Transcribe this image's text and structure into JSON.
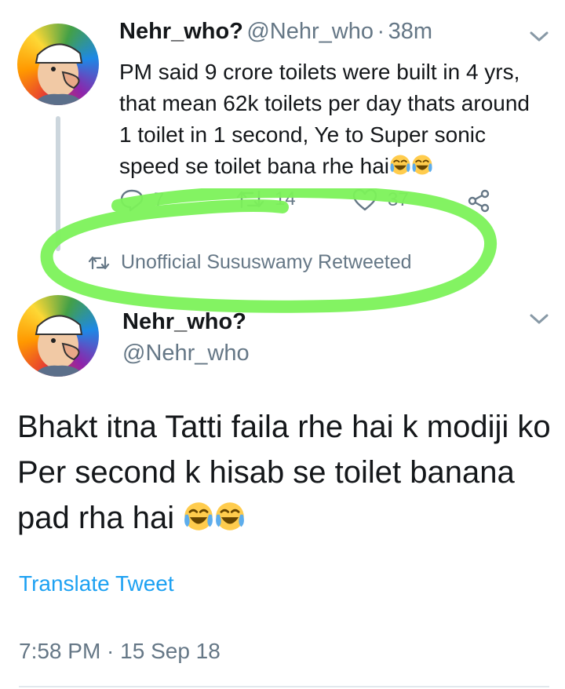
{
  "tweet1": {
    "display_name": "Nehr_who?",
    "handle": "@Nehr_who",
    "separator": "·",
    "time_ago": "38m",
    "text": "PM said 9 crore toilets were built in 4 yrs, that mean 62k toilets per day thats around 1 toilet in 1 second, Ye to Super sonic speed se toilet bana rhe hai",
    "reply_count": "7",
    "retweet_count": "14",
    "like_count": "37"
  },
  "retweet_context": {
    "label": "Unofficial Sususwamy Retweeted"
  },
  "tweet2": {
    "display_name": "Nehr_who?",
    "handle": "@Nehr_who",
    "text": "Bhakt itna Tatti faila rhe hai k modiji ko Per second k hisab se toilet banana pad rha hai",
    "translate_label": "Translate Tweet",
    "timestamp": "7:58 PM · 15 Sep 18"
  },
  "annotation": {
    "highlight_color": "#7cf25a"
  },
  "icons": [
    "reply-icon",
    "retweet-icon",
    "like-icon",
    "share-icon",
    "chevron-down-icon",
    "laughing-emoji-icon"
  ],
  "colors": {
    "text": "#14171a",
    "muted": "#657786",
    "link": "#1da1f2"
  }
}
